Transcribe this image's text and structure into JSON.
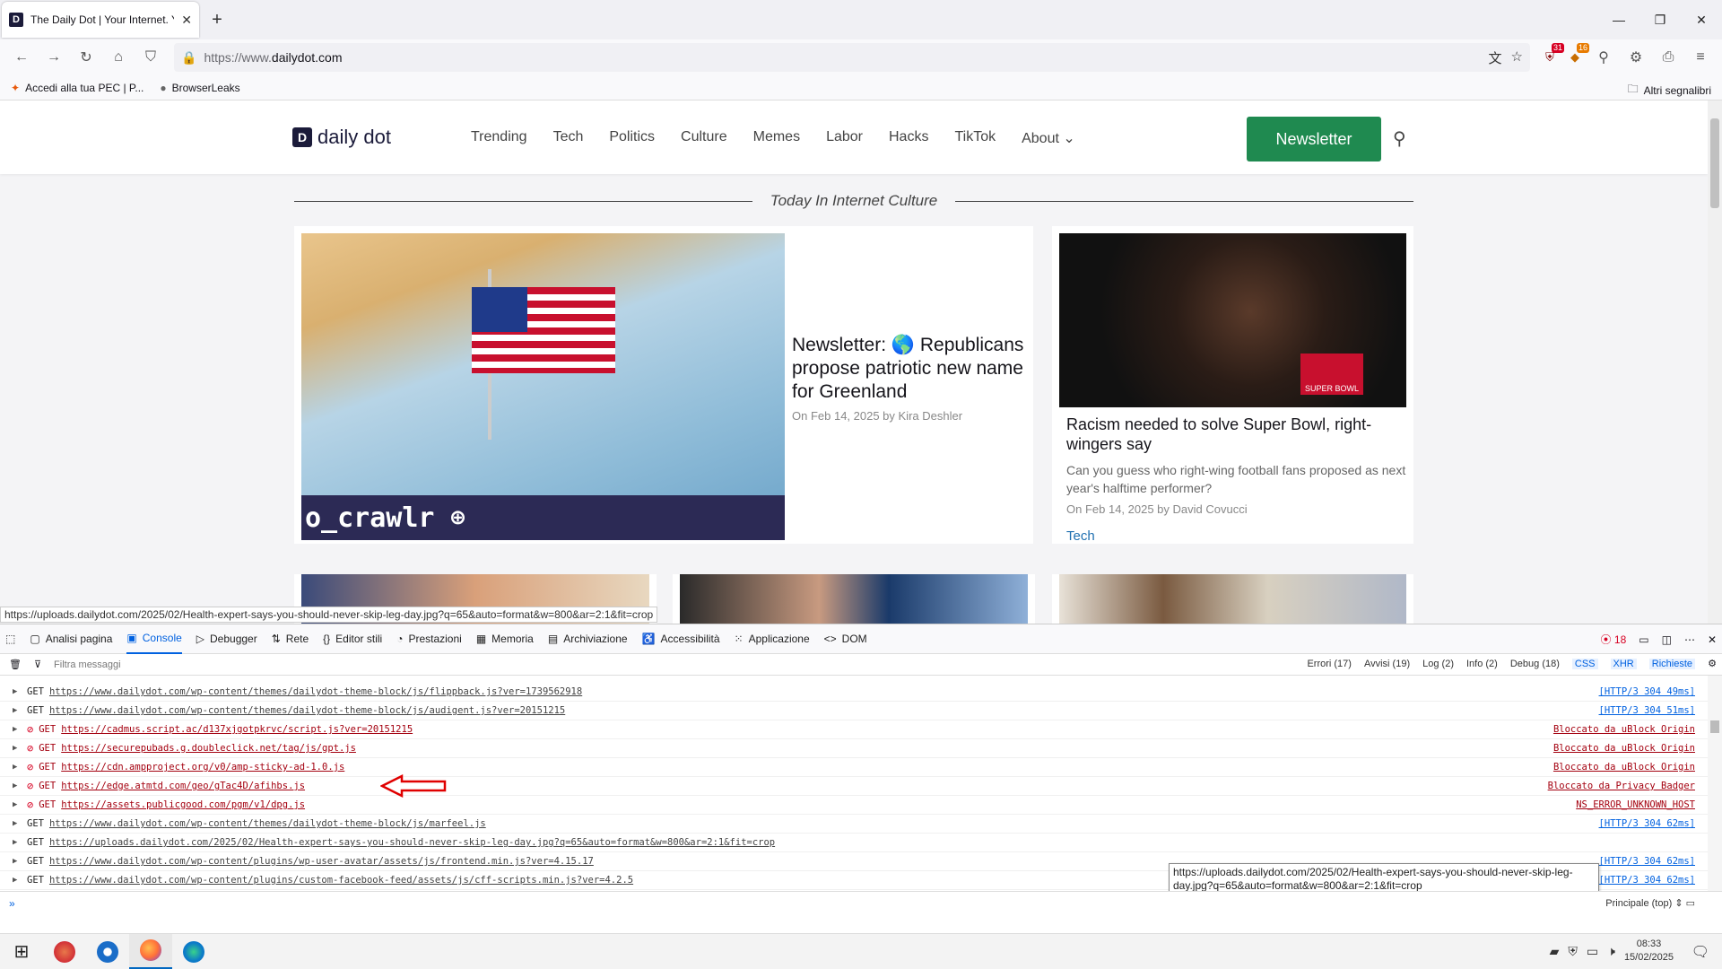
{
  "tab": {
    "title": "The Daily Dot | Your Internet. Yo",
    "favicon": "D"
  },
  "window": {
    "minimize": "—",
    "maximize": "❐",
    "close": "✕"
  },
  "nav": {
    "url_prefix": "https://www.",
    "url_host": "dailydot.com",
    "ext_badge_1": "31",
    "ext_badge_2": "16"
  },
  "bookmarks": [
    {
      "label": "Accedi alla tua PEC | P..."
    },
    {
      "label": "BrowserLeaks"
    }
  ],
  "bookmarks_other": "Altri segnalibri",
  "site": {
    "logo_text": "daily dot",
    "menu": [
      "Trending",
      "Tech",
      "Politics",
      "Culture",
      "Memes",
      "Labor",
      "Hacks",
      "TikTok",
      "About"
    ],
    "newsletter_button": "Newsletter",
    "section_title": "Today In Internet Culture",
    "article1": {
      "title": "Newsletter: 🌎 Republicans propose patriotic new name for Greenland",
      "meta": "On Feb 14, 2025 by Kira Deshler",
      "strip_text": "o_crawlr"
    },
    "article2": {
      "title": "Racism needed to solve Super Bowl, right-wingers say",
      "desc": "Can you guess who right-wing football fans proposed as next year's halftime performer?",
      "meta": "On Feb 14, 2025 by David Covucci",
      "tag": "Tech",
      "badge": "SUPER BOWL"
    }
  },
  "status_url": "https://uploads.dailydot.com/2025/02/Health-expert-says-you-should-never-skip-leg-day.jpg?q=65&auto=format&w=800&ar=2:1&fit=crop",
  "devtools": {
    "tabs": [
      "Analisi pagina",
      "Console",
      "Debugger",
      "Rete",
      "Editor stili",
      "Prestazioni",
      "Memoria",
      "Archiviazione",
      "Accessibilità",
      "Applicazione",
      "DOM"
    ],
    "error_count": "18",
    "filter_placeholder": "Filtra messaggi",
    "filters": [
      "Errori (17)",
      "Avvisi (19)",
      "Log (2)",
      "Info (2)",
      "Debug (18)"
    ],
    "req_filters": [
      "CSS",
      "XHR",
      "Richieste"
    ],
    "context": "Principale (top)",
    "prompt": "»"
  },
  "console_rows": [
    {
      "blocked": false,
      "method": "GET",
      "url": "https://www.dailydot.com/wp-content/themes/dailydot-theme-block/js/flippback.js?ver=1739562918",
      "result": "[HTTP/3  304  49ms]"
    },
    {
      "blocked": false,
      "method": "GET",
      "url": "https://www.dailydot.com/wp-content/themes/dailydot-theme-block/js/audigent.js?ver=20151215",
      "result": "[HTTP/3  304  51ms]"
    },
    {
      "blocked": true,
      "method": "GET",
      "url": "https://cadmus.script.ac/d137xjgotpkrvc/script.js?ver=20151215",
      "result": "Bloccato da uBlock Origin"
    },
    {
      "blocked": true,
      "method": "GET",
      "url": "https://securepubads.g.doubleclick.net/tag/js/gpt.js",
      "result": "Bloccato da uBlock Origin"
    },
    {
      "blocked": true,
      "method": "GET",
      "url": "https://cdn.ampproject.org/v0/amp-sticky-ad-1.0.js",
      "result": "Bloccato da uBlock Origin"
    },
    {
      "blocked": true,
      "method": "GET",
      "url": "https://edge.atmtd.com/geo/gTac4D/afihbs.js",
      "result": "Bloccato da Privacy Badger"
    },
    {
      "blocked": true,
      "method": "GET",
      "url": "https://assets.publicgood.com/pgm/v1/dpg.js",
      "result": "NS_ERROR_UNKNOWN_HOST"
    },
    {
      "blocked": false,
      "method": "GET",
      "url": "https://www.dailydot.com/wp-content/themes/dailydot-theme-block/js/marfeel.js",
      "result": "[HTTP/3  304  62ms]"
    },
    {
      "blocked": false,
      "method": "GET",
      "url": "https://uploads.dailydot.com/2025/02/Health-expert-says-you-should-never-skip-leg-day.jpg?q=65&auto=format&w=800&ar=2:1&fit=crop",
      "result": ""
    },
    {
      "blocked": false,
      "method": "GET",
      "url": "https://www.dailydot.com/wp-content/plugins/wp-user-avatar/assets/js/frontend.min.js?ver=4.15.17",
      "result": "[HTTP/3  304  62ms]"
    },
    {
      "blocked": false,
      "method": "GET",
      "url": "https://www.dailydot.com/wp-content/plugins/custom-facebook-feed/assets/js/cff-scripts.min.js?ver=4.2.5",
      "result": "[HTTP/3  304  62ms]"
    }
  ],
  "tooltip": "https://uploads.dailydot.com/2025/02/Health-expert-says-you-should-never-skip-leg-day.jpg?q=65&auto=format&w=800&ar=2:1&fit=crop",
  "taskbar": {
    "time": "08:33",
    "date": "15/02/2025"
  },
  "colors": {
    "accent": "#0061e0",
    "newsletter": "#1f8a50",
    "error": "#d70022"
  }
}
